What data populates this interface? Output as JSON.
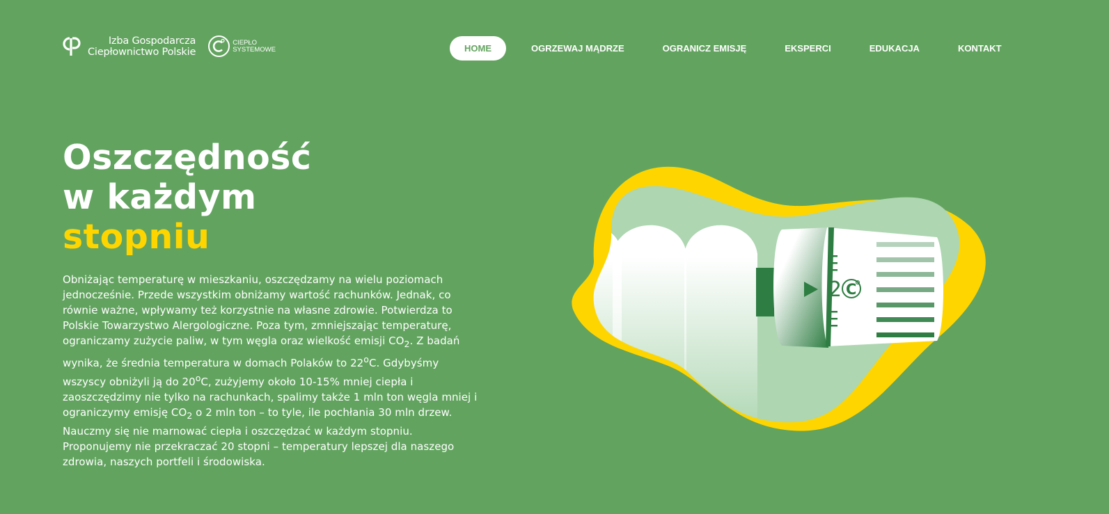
{
  "brand": {
    "org_name_line1": "Izba Gospodarcza",
    "org_name_line2": "Ciepłownictwo Polskie",
    "partner_line1": "CIEPŁO",
    "partner_line2": "SYSTEMOWE"
  },
  "nav": {
    "items": [
      {
        "label": "HOME",
        "active": true
      },
      {
        "label": "OGRZEWAJ MĄDRZE"
      },
      {
        "label": "OGRANICZ EMISJĘ"
      },
      {
        "label": "EKSPERCI"
      },
      {
        "label": "EDUKACJA"
      },
      {
        "label": "KONTAKT"
      }
    ]
  },
  "hero": {
    "title_line1": "Oszczędność",
    "title_line2": "w każdym",
    "title_accent": "stopniu",
    "accent_color": "#ffd500",
    "paragraph1_a": "Obniżając temperaturę w mieszkaniu, oszczędzamy na wielu poziomach jednocześnie. Przede wszystkim obniżamy wartość rachunków. Jednak, co równie ważne, wpływamy też korzystnie na własne zdrowie. Potwierdza to Polskie Towarzystwo Alergologiczne. Poza tym, zmniejszając temperaturę, ograniczamy zużycie paliw, w tym węgla oraz wielkość emisji CO",
    "paragraph1_sub1": "2",
    "paragraph1_b": ". Z badań wynika, że średnia temperatura w domach Polaków to 22",
    "paragraph1_sup1": "o",
    "paragraph1_c": "C. Gdybyśmy wszyscy obniżyli ją do 20",
    "paragraph1_sup2": "o",
    "paragraph1_d": "C, zużyjemy około 10-15% mniej ciepła i zaoszczędzimy nie tylko na rachunkach, spalimy także 1 mln ton węgla mniej i ograniczymy emisję CO",
    "paragraph1_sub2": "2",
    "paragraph1_e": " o 2 mln ton – to tyle, ile pochłania 30 mln drzew.",
    "paragraph2": "Nauczmy się nie marnować ciepła i oszczędzać w każdym stopniu. Proponujemy nie przekraczać 20 stopni – temperatury lepszej dla naszego zdrowia, naszych portfeli i środowiska."
  },
  "illustration": {
    "dial_value": "2",
    "dial_unit_symbol": "C",
    "colors": {
      "background": "#62a45f",
      "blob_yellow": "#ffd500",
      "blob_light_green": "#add6b1",
      "dark_green": "#2e7d42"
    }
  }
}
